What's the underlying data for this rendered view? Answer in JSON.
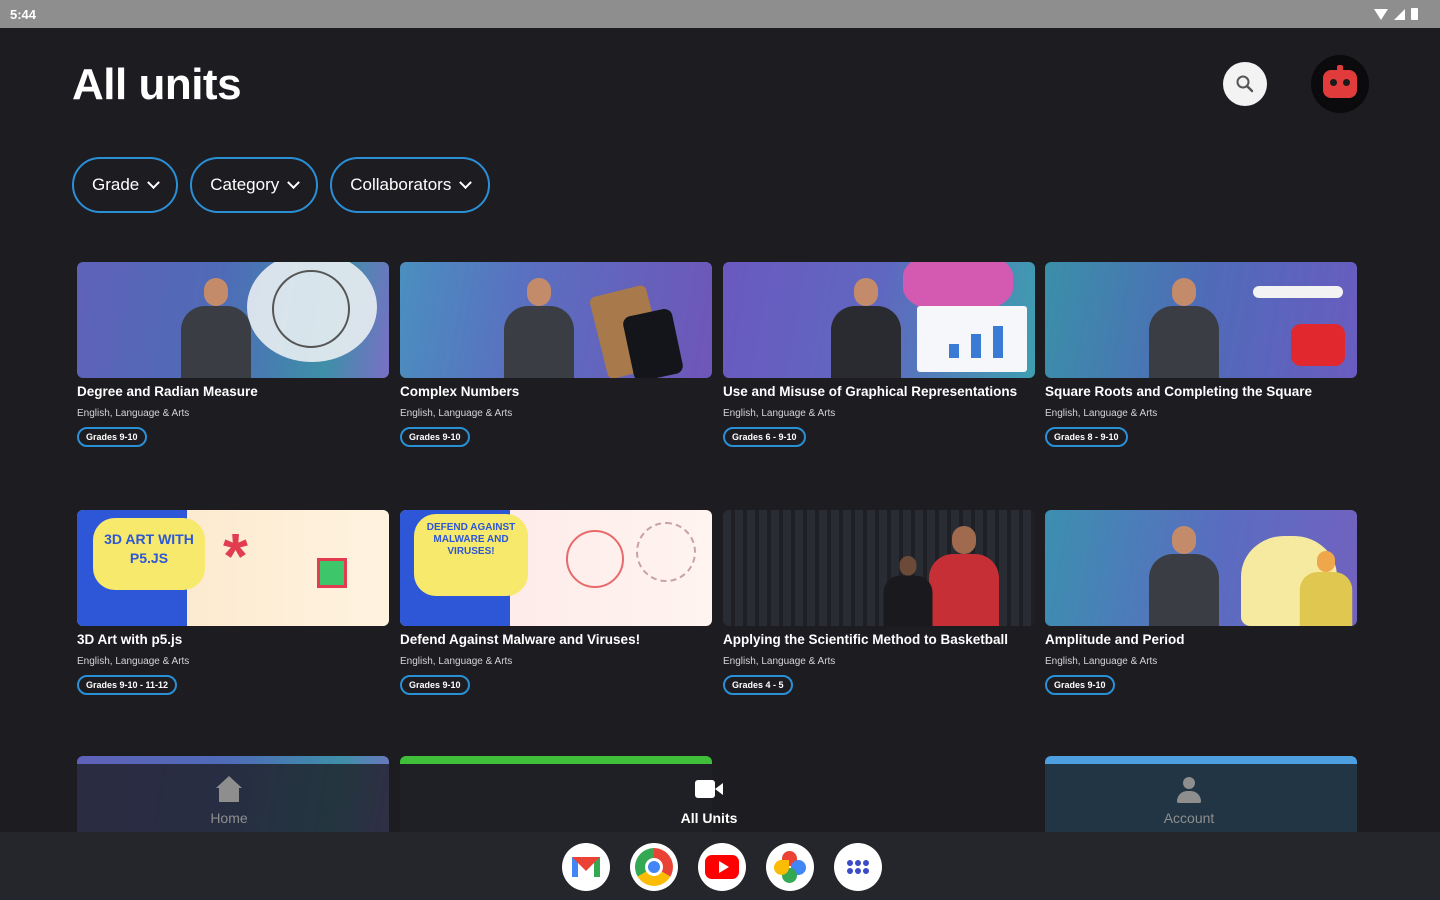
{
  "statusbar": {
    "time": "5:44"
  },
  "header": {
    "title": "All units"
  },
  "filters": [
    {
      "label": "Grade"
    },
    {
      "label": "Category"
    },
    {
      "label": "Collaborators"
    }
  ],
  "units": [
    {
      "title": "Degree and Radian Measure",
      "category": "English, Language & Arts",
      "grades": "Grades 9-10"
    },
    {
      "title": "Complex Numbers",
      "category": "English, Language & Arts",
      "grades": "Grades 9-10"
    },
    {
      "title": "Use and Misuse of Graphical Representations",
      "category": "English, Language & Arts",
      "grades": "Grades 6 - 9-10"
    },
    {
      "title": "Square Roots and Completing the Square",
      "category": "English, Language & Arts",
      "grades": "Grades 8 - 9-10"
    },
    {
      "title": "3D Art with p5.js",
      "category": "English, Language & Arts",
      "grades": "Grades 9-10 - 11-12",
      "thumb_text": "3D ART WITH P5.JS"
    },
    {
      "title": "Defend Against Malware and Viruses!",
      "category": "English, Language & Arts",
      "grades": "Grades 9-10",
      "thumb_text": "DEFEND AGAINST MALWARE AND VIRUSES!"
    },
    {
      "title": "Applying the Scientific Method to Basketball",
      "category": "English, Language & Arts",
      "grades": "Grades 4 - 5"
    },
    {
      "title": "Amplitude and Period",
      "category": "English, Language & Arts",
      "grades": "Grades 9-10"
    }
  ],
  "bottom_nav": {
    "home": "Home",
    "all_units": "All Units",
    "account": "Account"
  },
  "dock": [
    "gmail-icon",
    "chrome-icon",
    "youtube-icon",
    "photos-icon",
    "app-drawer-icon"
  ],
  "colors": {
    "accent": "#2b8fd6",
    "background": "#1c1c21"
  }
}
